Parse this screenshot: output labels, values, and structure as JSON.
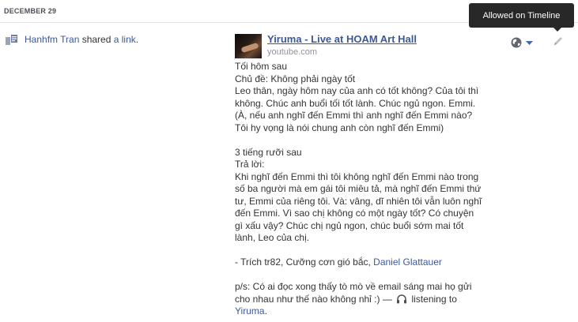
{
  "timeline": {
    "date": "DECEMBER 29"
  },
  "activity": {
    "actor": "Hanhfm Tran",
    "verb": " shared ",
    "object": "a link",
    "end": "."
  },
  "link": {
    "title": "Yiruma - Live at HOAM Art Hall",
    "source": "youtube.com"
  },
  "tooltip": {
    "text": "Allowed on Timeline"
  },
  "icons": {
    "share": "share-link-icon",
    "audience": "globe-icon",
    "caret": "caret-down-icon",
    "edit": "pencil-icon",
    "music": "headphones-icon"
  },
  "post": {
    "lines": [
      "Tối hôm sau",
      "Chủ đề: Không phải ngày tốt",
      "Leo thân, ngày hôm nay của anh có tốt không? Của tôi thì",
      "không. Chúc anh buổi tối tốt lành. Chúc ngủ ngon. Emmi.",
      "(À, nếu anh nghĩ đến Emmi thì anh nghĩ đến Emmi nào?",
      "Tôi hy vọng là nói chung anh còn nghĩ đến Emmi)",
      "",
      "3 tiếng rưỡi sau",
      "Trả lời:",
      "Khi nghĩ đến Emmi thì tôi không nghĩ đến Emmi nào trong",
      "số ba người mà em gái tôi miêu tả, mà nghĩ đến Emmi thứ",
      "tư, Emmi của riêng tôi. Và: vâng, dĩ nhiên tôi vẫn luôn nghĩ",
      "đến Emmi. Vì sao chị không có một ngày tốt? Có chuyện",
      "gì xấu vậy? Chúc chị ngủ ngon, chúc buổi sớm mai tốt",
      "lành, Leo của chị.",
      ""
    ],
    "citation_prefix": "- Trích tr82, Cưỡng cơn gió bắc, ",
    "citation_author": "Daniel Glattauer",
    "ps_line1": "p/s: Có ai đọc xong thấy tò mò về email sáng mai họ gửi",
    "ps_line2_prefix": "cho nhau như thế nào không nhỉ :) — ",
    "listening_text": " listening to",
    "listening_target": "Yiruma",
    "listening_end": "."
  }
}
